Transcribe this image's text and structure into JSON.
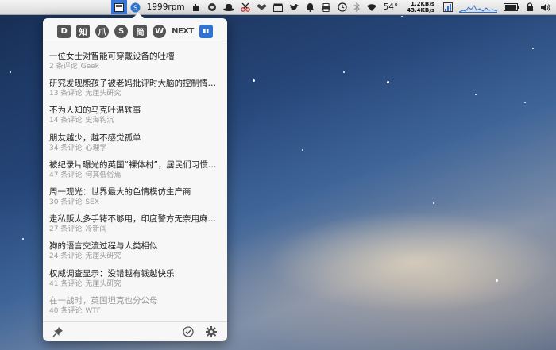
{
  "menubar": {
    "rpm": "1999rpm",
    "temp": "54°",
    "net_up": "1.2KB/s",
    "net_down": "43.4KB/s",
    "icons": [
      "window-icon",
      "app-badge-icon",
      "scissors-icon",
      "dropbox-icon",
      "twitter-icon",
      "bell-icon",
      "clock-icon",
      "bluetooth-icon",
      "wifi-icon",
      "cpu-icon",
      "activity-graph-icon",
      "battery-icon",
      "lock-icon",
      "volume-icon"
    ]
  },
  "toolbar": {
    "sources": [
      {
        "name": "source-d",
        "label": "D"
      },
      {
        "name": "source-zhihu",
        "label": "知"
      },
      {
        "name": "source-paw",
        "label": "爪"
      },
      {
        "name": "source-s",
        "label": "S"
      },
      {
        "name": "source-jian",
        "label": "简"
      },
      {
        "name": "source-w",
        "label": "W"
      },
      {
        "name": "source-next",
        "label": "NEXT"
      },
      {
        "name": "source-book",
        "label": "▮▮"
      }
    ]
  },
  "items": [
    {
      "title": "一位女士对智能可穿戴设备的吐槽",
      "count": "2 条评论",
      "source": "Geek"
    },
    {
      "title": "研究发现熊孩子被老妈批评时大脑的控制情…",
      "count": "13 条评论",
      "source": "无厘头研究"
    },
    {
      "title": "不为人知的马克吐温轶事",
      "count": "14 条评论",
      "source": "史海钩沉"
    },
    {
      "title": "朋友越少，越不感觉孤单",
      "count": "34 条评论",
      "source": "心理学"
    },
    {
      "title": "被纪录片曝光的英国“裸体村”，居民们习惯…",
      "count": "47 条评论",
      "source": "何其低俗焉"
    },
    {
      "title": "周一观光：世界最大的色情模仿生产商",
      "count": "30 条评论",
      "source": "SEX"
    },
    {
      "title": "走私贩太多手铐不够用，印度警方无奈用麻…",
      "count": "27 条评论",
      "source": "冷新闻"
    },
    {
      "title": "狗的语言交流过程与人类相似",
      "count": "24 条评论",
      "source": "无厘头研究"
    },
    {
      "title": "权威调查显示：没错越有钱越快乐",
      "count": "41 条评论",
      "source": "无厘头研究"
    },
    {
      "title": "在一战时，英国坦克也分公母",
      "count": "40 条评论",
      "source": "WTF"
    }
  ]
}
